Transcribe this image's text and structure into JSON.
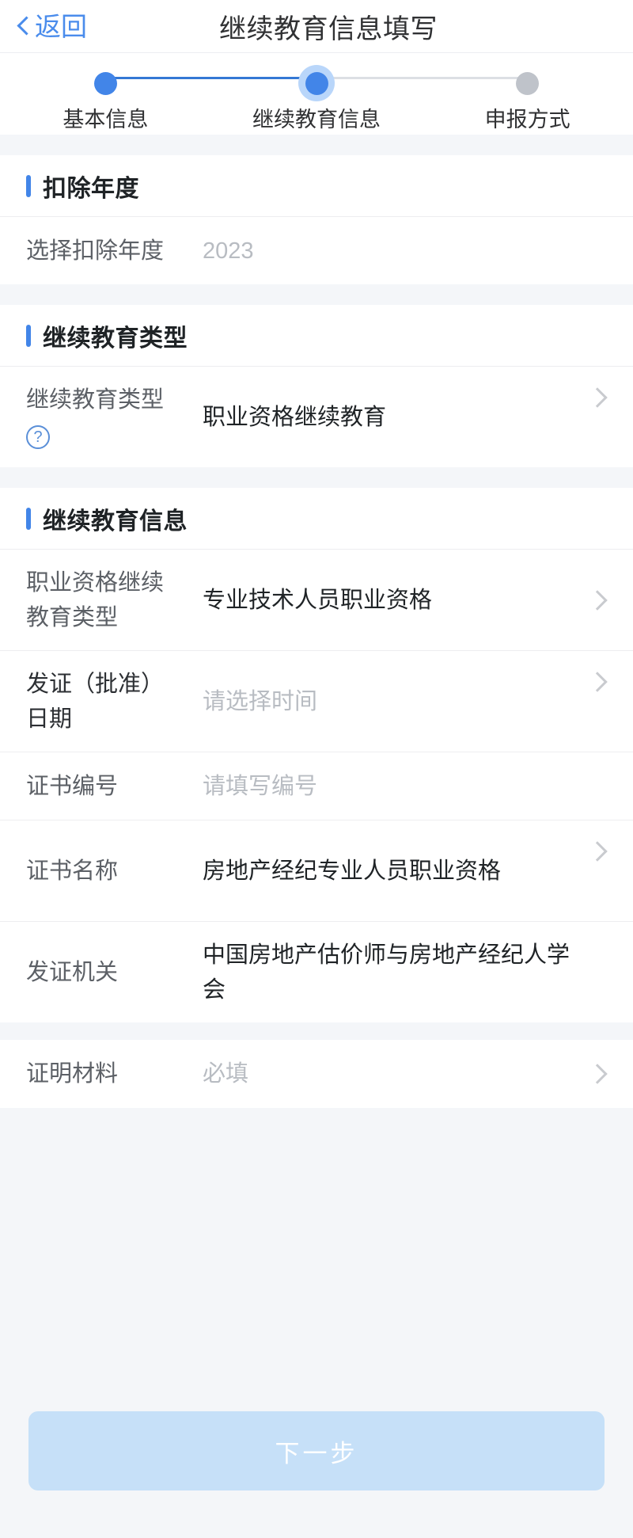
{
  "navbar": {
    "back_label": "返回",
    "title": "继续教育信息填写"
  },
  "stepper": {
    "steps": [
      {
        "label": "基本信息",
        "state": "done"
      },
      {
        "label": "继续教育信息",
        "state": "current"
      },
      {
        "label": "申报方式",
        "state": "pending"
      }
    ]
  },
  "sections": [
    {
      "title": "扣除年度",
      "rows": [
        {
          "label": "选择扣除年度",
          "value": "2023",
          "value_is_placeholder": true,
          "chevron": false
        }
      ]
    },
    {
      "title": "继续教育类型",
      "rows": [
        {
          "label": "继续教育类型",
          "help_icon": "question-circle-icon",
          "value": "职业资格继续教育",
          "value_is_placeholder": false,
          "chevron": true
        }
      ]
    },
    {
      "title": "继续教育信息",
      "rows": [
        {
          "label": "职业资格继续教育类型",
          "value": "专业技术人员职业资格",
          "value_is_placeholder": false,
          "chevron": true
        },
        {
          "label": "发证（批准）日期",
          "value": "请选择时间",
          "value_is_placeholder": true,
          "chevron": true
        },
        {
          "label": "证书编号",
          "value": "请填写编号",
          "value_is_placeholder": true,
          "chevron": false
        },
        {
          "label": "证书名称",
          "value": "房地产经纪专业人员职业资格",
          "value_is_placeholder": false,
          "chevron": true
        },
        {
          "label": "发证机关",
          "value": "中国房地产估价师与房地产经纪人学会",
          "value_is_placeholder": false,
          "chevron": false
        }
      ]
    },
    {
      "title": "",
      "rows": [
        {
          "label": "证明材料",
          "value": "必填",
          "value_is_placeholder": true,
          "chevron": true
        }
      ]
    }
  ],
  "footer": {
    "next_label": "下一步",
    "next_disabled": true
  },
  "colors": {
    "accent": "#4285e8",
    "link": "#4a8cec",
    "track_done": "#3478d4",
    "track_todo": "#dcdfe4",
    "pending_dot": "#bfc3ca",
    "halo": "#b9d6fa",
    "button_disabled": "#c6e0f8",
    "page_bg": "#f4f6f9",
    "card_bg": "#ffffff",
    "text_primary": "#1f2326",
    "text_label": "#5c6066",
    "text_placeholder": "#b8bcc2",
    "chevron": "#c9cbcf"
  }
}
